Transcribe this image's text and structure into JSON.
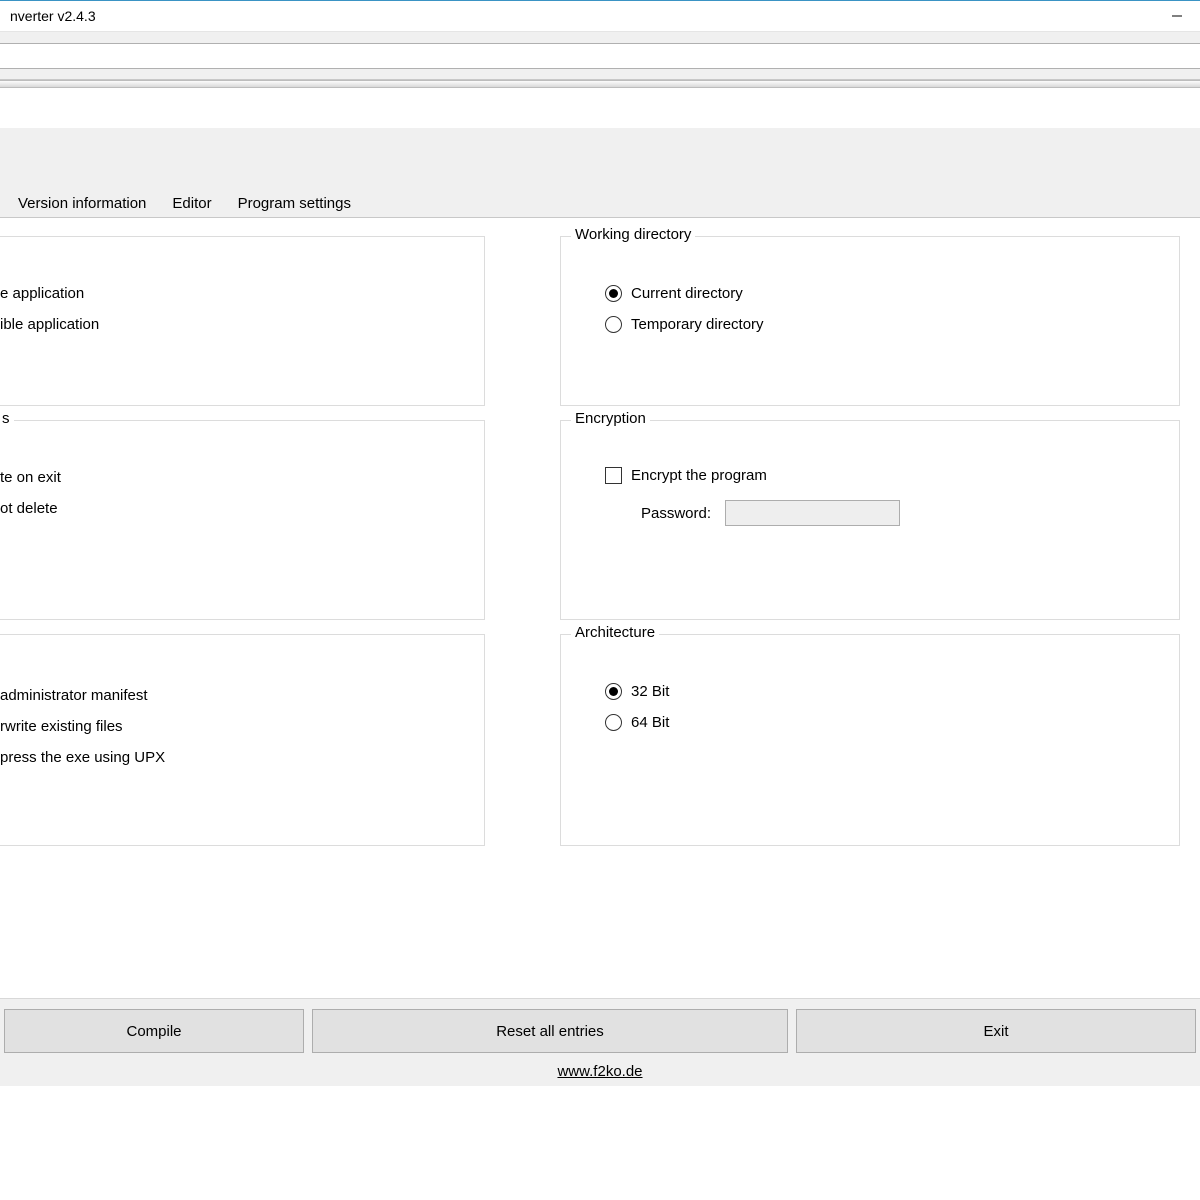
{
  "window": {
    "title": "nverter v2.4.3"
  },
  "tabs": {
    "version_info": "Version information",
    "editor": "Editor",
    "program_settings": "Program settings"
  },
  "left_col": {
    "group1": {
      "opt1_frag": "e application",
      "opt2_frag": "ible application"
    },
    "group2": {
      "legend_frag": "s",
      "opt1_frag": "te on exit",
      "opt2_frag": "ot delete"
    },
    "group3": {
      "opt1_frag": "administrator manifest",
      "opt2_frag": "rwrite existing files",
      "opt3_frag": "press the exe using UPX"
    }
  },
  "right_col": {
    "working_dir": {
      "legend": "Working directory",
      "current": "Current directory",
      "temp": "Temporary directory"
    },
    "encryption": {
      "legend": "Encryption",
      "encrypt": "Encrypt the program",
      "password_label": "Password:"
    },
    "architecture": {
      "legend": "Architecture",
      "b32": "32 Bit",
      "b64": "64 Bit"
    }
  },
  "buttons": {
    "compile": "Compile",
    "reset": "Reset all entries",
    "exit": "Exit"
  },
  "footer_link": "www.f2ko.de"
}
